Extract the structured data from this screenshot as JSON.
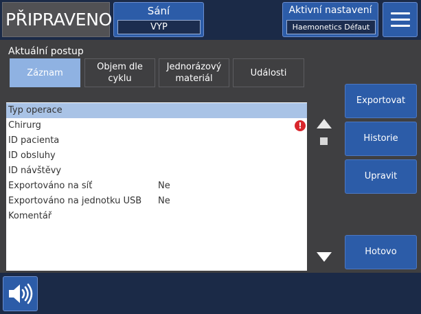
{
  "header": {
    "status": "PŘIPRAVENO",
    "suction_title": "Sání",
    "suction_value": "VYP",
    "active_title": "Aktivní nastavení",
    "active_value": "Haemonetics Défaut",
    "menu_icon": "hamburger-menu-icon"
  },
  "section": {
    "title": "Aktuální postup"
  },
  "tabs": [
    {
      "label": "Záznam",
      "active": true
    },
    {
      "label": "Objem dle cyklu",
      "active": false
    },
    {
      "label": "Jednorázový materiál",
      "active": false
    },
    {
      "label": "Události",
      "active": false
    }
  ],
  "list": {
    "rows": [
      {
        "label": "Typ operace",
        "value": "",
        "selected": true
      },
      {
        "label": "Chirurg",
        "value": "",
        "warning": true
      },
      {
        "label": "ID pacienta",
        "value": ""
      },
      {
        "label": "ID obsluhy",
        "value": ""
      },
      {
        "label": "ID návštěvy",
        "value": ""
      },
      {
        "label": "Exportováno na síť",
        "value": "Ne"
      },
      {
        "label": "Exportováno na jednotku USB",
        "value": "Ne"
      },
      {
        "label": "Komentář",
        "value": ""
      }
    ],
    "warning_glyph": "!"
  },
  "actions": {
    "export": "Exportovat",
    "history": "Historie",
    "edit": "Upravit",
    "done": "Hotovo"
  },
  "footer": {
    "speaker_icon": "speaker-volume-icon"
  },
  "colors": {
    "header_bg": "#1b2a47",
    "button_blue": "#2c5ca8",
    "active_tab": "#8fb2e2",
    "selected_row": "#a9c3e6",
    "warning_red": "#d9262c"
  }
}
